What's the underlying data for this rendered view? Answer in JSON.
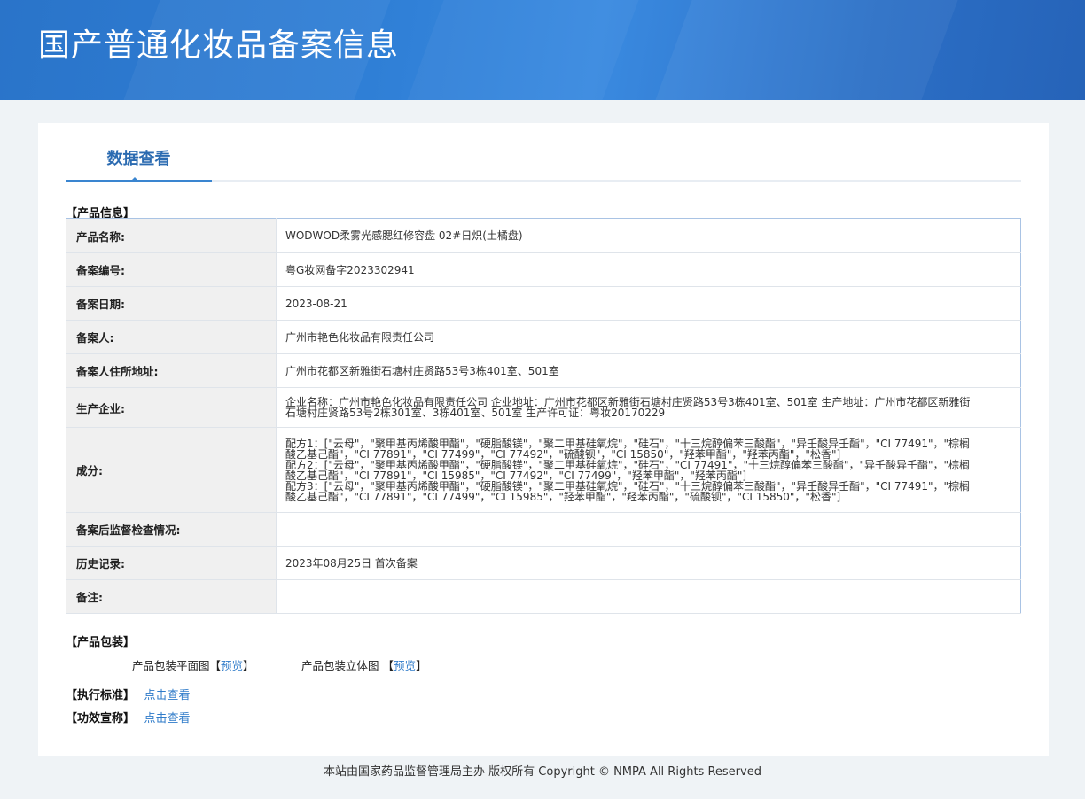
{
  "header": {
    "title": "国产普通化妆品备案信息"
  },
  "tabs": [
    {
      "label": "数据查看"
    }
  ],
  "product_info": {
    "section_title": "【产品信息】",
    "rows": [
      {
        "label": "产品名称:",
        "value": "WODWOD柔雾光感腮红修容盘 02#日炽(土橘盘)"
      },
      {
        "label": "备案编号:",
        "value": "粤G妆网备字2023302941"
      },
      {
        "label": "备案日期:",
        "value": "2023-08-21"
      },
      {
        "label": "备案人:",
        "value": "广州市艳色化妆品有限责任公司"
      },
      {
        "label": "备案人住所地址:",
        "value": "广州市花都区新雅街石塘村庄贤路53号3栋401室、501室"
      },
      {
        "label": "生产企业:",
        "value": "企业名称：广州市艳色化妆品有限责任公司 企业地址：广州市花都区新雅街石塘村庄贤路53号3栋401室、501室 生产地址：广州市花都区新雅街石塘村庄贤路53号2栋301室、3栋401室、501室 生产许可证：粤妆20170229"
      },
      {
        "label": "成分:",
        "value": "配方1：[\"云母\"，\"聚甲基丙烯酸甲酯\"，\"硬脂酸镁\"，\"聚二甲基硅氧烷\"，\"硅石\"，\"十三烷醇偏苯三酸酯\"，\"异壬酸异壬酯\"，\"CI 77491\"，\"棕榈酸乙基己酯\"，\"CI 77891\"，\"CI 77499\"，\"CI 77492\"，\"硫酸钡\"，\"CI 15850\"，\"羟苯甲酯\"，\"羟苯丙酯\"，\"松香\"]\n配方2：[\"云母\"，\"聚甲基丙烯酸甲酯\"，\"硬脂酸镁\"，\"聚二甲基硅氧烷\"，\"硅石\"，\"CI 77491\"，\"十三烷醇偏苯三酸酯\"，\"异壬酸异壬酯\"，\"棕榈酸乙基己酯\"，\"CI 77891\"，\"CI 15985\"，\"CI 77492\"，\"CI 77499\"，\"羟苯甲酯\"，\"羟苯丙酯\"]\n配方3：[\"云母\"，\"聚甲基丙烯酸甲酯\"，\"硬脂酸镁\"，\"聚二甲基硅氧烷\"，\"硅石\"，\"十三烷醇偏苯三酸酯\"，\"异壬酸异壬酯\"，\"CI 77491\"，\"棕榈酸乙基己酯\"，\"CI 77891\"，\"CI 77499\"，\"CI 15985\"，\"羟苯甲酯\"，\"羟苯丙酯\"，\"硫酸钡\"，\"CI 15850\"，\"松香\"]"
      },
      {
        "label": "备案后监督检查情况:",
        "value": ""
      },
      {
        "label": "历史记录:",
        "value": "2023年08月25日 首次备案"
      },
      {
        "label": "备注:",
        "value": ""
      }
    ]
  },
  "packaging": {
    "section_title": "【产品包装】",
    "flat_label": "产品包装平面图",
    "stereo_label": "产品包装立体图",
    "bracket_open": "【",
    "bracket_close": "】",
    "preview_link": "预览"
  },
  "standard": {
    "section_title": "【执行标准】",
    "link": "点击查看"
  },
  "efficacy": {
    "section_title": "【功效宣称】",
    "link": "点击查看"
  },
  "footer": {
    "text": "本站由国家药品监督管理局主办 版权所有 Copyright © NMPA All Rights Reserved"
  },
  "colors": {
    "header_blue": "#2f7fd6",
    "link_blue": "#2f7bc9",
    "tab_blue": "#2b6bb1"
  }
}
